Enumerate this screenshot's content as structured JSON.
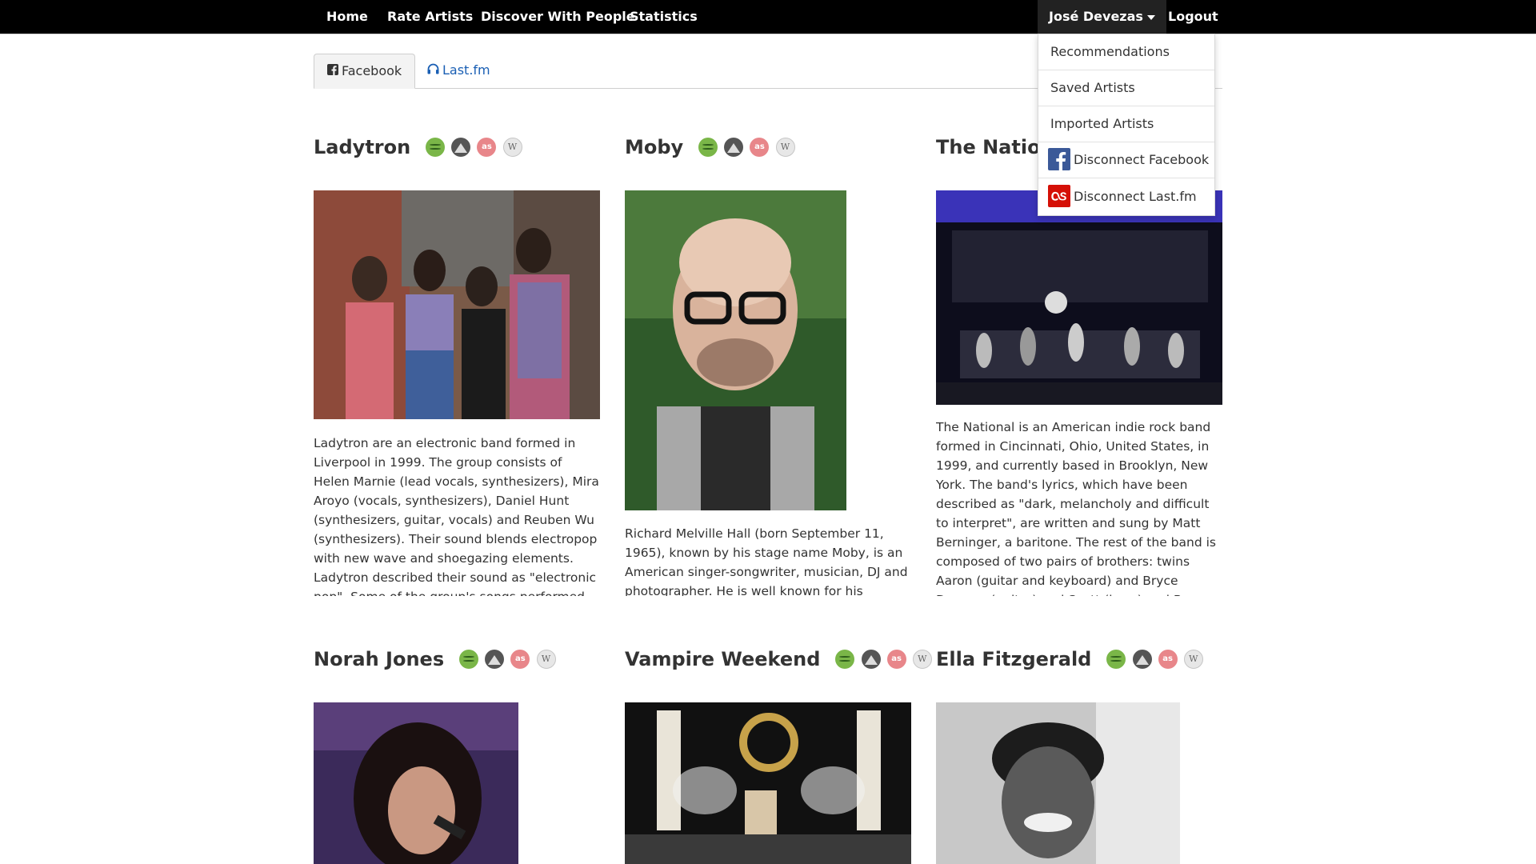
{
  "navbar": {
    "items": [
      "Home",
      "Rate Artists",
      "Discover With People",
      "Statistics"
    ],
    "user": "José Devezas",
    "logout": "Logout"
  },
  "dropdown": {
    "items": [
      "Recommendations",
      "Saved Artists",
      "Imported Artists"
    ],
    "disconnect_facebook": "Disconnect Facebook",
    "disconnect_lastfm": "Disconnect Last.fm"
  },
  "tabs": {
    "facebook": "Facebook",
    "lastfm": "Last.fm"
  },
  "artists": [
    {
      "name": "Ladytron",
      "bio": "Ladytron are an electronic band formed in Liverpool in 1999. The group consists of Helen Marnie (lead vocals, synthesizers), Mira Aroyo (vocals, synthesizers), Daniel Hunt (synthesizers, guitar, vocals) and Reuben Wu (synthesizers). Their sound blends electropop with new wave and shoegazing elements. Ladytron described their sound as \"electronic pop\". Some of the group's songs performed by Aroyo contain lyrics"
    },
    {
      "name": "Moby",
      "bio": "Richard Melville Hall (born September 11, 1965), known by his stage name Moby, is an American singer-songwriter, musician, DJ and photographer. He is well known for his electronic"
    },
    {
      "name": "The National",
      "bio": "The National is an American indie rock band formed in Cincinnati, Ohio, United States, in 1999, and currently based in Brooklyn, New York. The band's lyrics, which have been described as \"dark, melancholy and difficult to interpret\", are written and sung by Matt Berninger, a baritone. The rest of the band is composed of two pairs of brothers: twins Aaron (guitar and keyboard) and Bryce Dessner (guitar) and Scott (bass) and Bryan"
    },
    {
      "name": "Norah Jones",
      "bio": ""
    },
    {
      "name": "Vampire Weekend",
      "bio": ""
    },
    {
      "name": "Ella Fitzgerald",
      "bio": ""
    }
  ],
  "service_icons": [
    "spotify-icon",
    "grooveshark-icon",
    "lastfm-icon",
    "wikipedia-icon"
  ],
  "colors": {
    "navbar": "#000000",
    "link": "#1a5fb4",
    "facebook": "#3b5998",
    "lastfm": "#d51007"
  }
}
